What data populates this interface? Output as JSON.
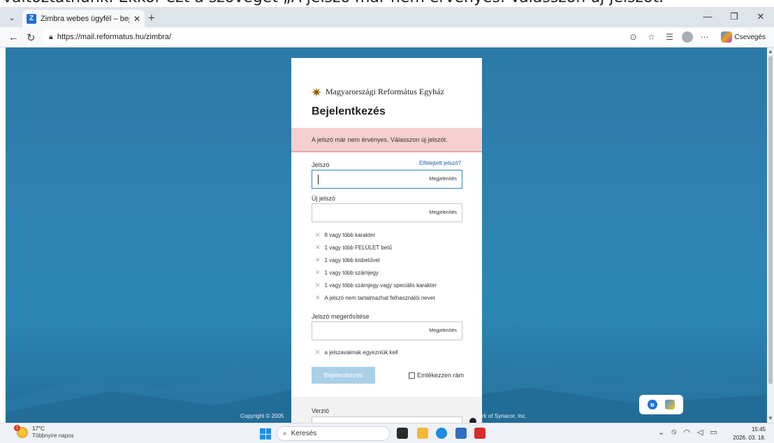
{
  "caption": "változtatnunk. Ekkor ezt a szöveget „A jelszó már nem érvényes. Válasszon új jelszót.",
  "browser": {
    "tab_title": "Zimbra webes ügyfél – bejelentkez",
    "tab_favicon": "Z",
    "url": "https://mail.reformatus.hu/zimbra/",
    "copilot_label": "Csevegés"
  },
  "login": {
    "brand": "Magyarországi Református Egyház",
    "title": "Bejelentkezés",
    "alert": "A jelszó már nem érvényes. Válasszon új jelszót.",
    "password_label": "Jelszó",
    "forgot_link": "Elfelejtett jelszó?",
    "show_label": "Megjelenítés",
    "new_password_label": "Új jelszó",
    "requirements": [
      "8 vagy több karakter",
      "1 vagy több FELÜLET betű",
      "1 vagy több kisbetűvel",
      "1 vagy több számjegy",
      "1 vagy több számjegy vagy speciális karakter",
      "A jelszó nem tartalmazhat felhasználói nevet"
    ],
    "confirm_label": "Jelszó megerősítése",
    "match_requirement": "a jelszavaknak egyezniük kell",
    "login_button": "Bejelentkezés",
    "remember_label": "Emlékezzen rám",
    "version_label": "Verzió"
  },
  "footer": {
    "copyright_left": "Copyright © 2005",
    "copyright_right": "rk of Synacor, Inc."
  },
  "taskbar": {
    "temperature": "17°C",
    "weather_desc": "Többnyire napos",
    "weather_badge": "1",
    "search_placeholder": "Keresés",
    "time": "15:45",
    "date": "2026. 03. 18."
  },
  "colors": {
    "accent": "#2f80c1",
    "alert_bg": "#f5cfcf",
    "button_disabled": "#a9cfe9",
    "background_blue": "#2c86b4"
  }
}
